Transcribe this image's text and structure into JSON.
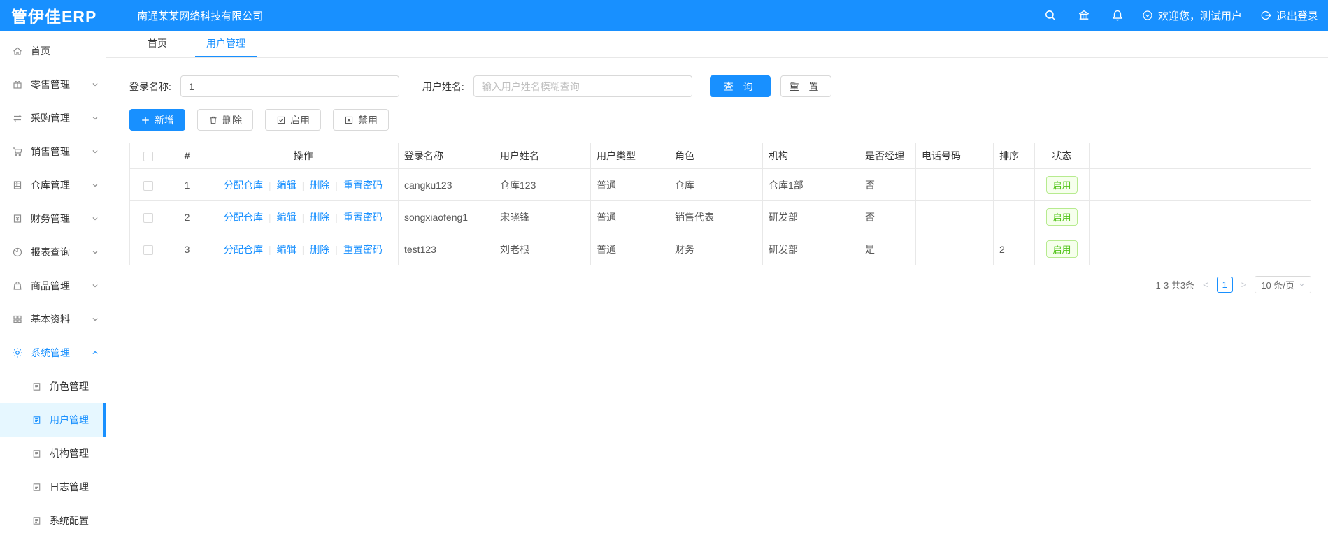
{
  "colors": {
    "primary": "#1890ff",
    "header-bg": "#1890ff",
    "active-bg": "#e6f7ff",
    "border": "#e8e8e8",
    "input-border": "#d9d9d9",
    "text": "#595959",
    "text-dark": "#333333",
    "icon": "#8c8c8c",
    "placeholder": "#bfbfbf",
    "green": "#52c41a",
    "green-border": "#b7eb8f",
    "green-bg": "#f6ffed"
  },
  "header": {
    "logo": "管伊佳ERP",
    "company": "南通某某网络科技有限公司",
    "icons": [
      "search-icon",
      "bank-icon",
      "bell-icon"
    ],
    "welcome": "欢迎您，测试用户",
    "logout": "退出登录"
  },
  "sidebar": {
    "items": [
      {
        "label": "首页",
        "icon": "home-icon",
        "arrow": ""
      },
      {
        "label": "零售管理",
        "icon": "retail-icon",
        "arrow": "down"
      },
      {
        "label": "采购管理",
        "icon": "purchase-icon",
        "arrow": "down"
      },
      {
        "label": "销售管理",
        "icon": "sales-cart-icon",
        "arrow": "down"
      },
      {
        "label": "仓库管理",
        "icon": "warehouse-icon",
        "arrow": "down"
      },
      {
        "label": "财务管理",
        "icon": "finance-icon",
        "arrow": "down"
      },
      {
        "label": "报表查询",
        "icon": "report-icon",
        "arrow": "down"
      },
      {
        "label": "商品管理",
        "icon": "goods-icon",
        "arrow": "down"
      },
      {
        "label": "基本资料",
        "icon": "basic-data-icon",
        "arrow": "down"
      },
      {
        "label": "系统管理",
        "icon": "gear-icon",
        "arrow": "up",
        "active": true
      }
    ],
    "subitems": [
      {
        "label": "角色管理",
        "icon": "doc-icon"
      },
      {
        "label": "用户管理",
        "icon": "doc-icon",
        "active": true
      },
      {
        "label": "机构管理",
        "icon": "doc-icon"
      },
      {
        "label": "日志管理",
        "icon": "doc-icon"
      },
      {
        "label": "系统配置",
        "icon": "doc-icon"
      }
    ]
  },
  "tabs": [
    {
      "label": "首页"
    },
    {
      "label": "用户管理",
      "active": true
    }
  ],
  "filter": {
    "login_label": "登录名称:",
    "login_value": "1",
    "name_label": "用户姓名:",
    "name_placeholder": "输入用户姓名模糊查询",
    "search_label": "查 询",
    "reset_label": "重 置"
  },
  "toolbar": {
    "add": "新增",
    "delete": "删除",
    "enable": "启用",
    "disable": "禁用"
  },
  "table": {
    "headers": {
      "index": "#",
      "op": "操作",
      "login": "登录名称",
      "name": "用户姓名",
      "type": "用户类型",
      "role": "角色",
      "org": "机构",
      "manager": "是否经理",
      "phone": "电话号码",
      "sort": "排序",
      "status": "状态"
    },
    "action_links": [
      "分配仓库",
      "编辑",
      "删除",
      "重置密码"
    ],
    "rows": [
      {
        "index": "1",
        "login": "cangku123",
        "name": "仓库123",
        "type": "普通",
        "role": "仓库",
        "org": "仓库1部",
        "manager": "否",
        "phone": "",
        "sort": "",
        "status": "启用"
      },
      {
        "index": "2",
        "login": "songxiaofeng1",
        "name": "宋晓锋",
        "type": "普通",
        "role": "销售代表",
        "org": "研发部",
        "manager": "否",
        "phone": "",
        "sort": "",
        "status": "启用"
      },
      {
        "index": "3",
        "login": "test123",
        "name": "刘老根",
        "type": "普通",
        "role": "财务",
        "org": "研发部",
        "manager": "是",
        "phone": "",
        "sort": "2",
        "status": "启用"
      }
    ]
  },
  "pagination": {
    "total": "1-3 共3条",
    "prev": "<",
    "page": "1",
    "next": ">",
    "page_size": "10 条/页"
  }
}
